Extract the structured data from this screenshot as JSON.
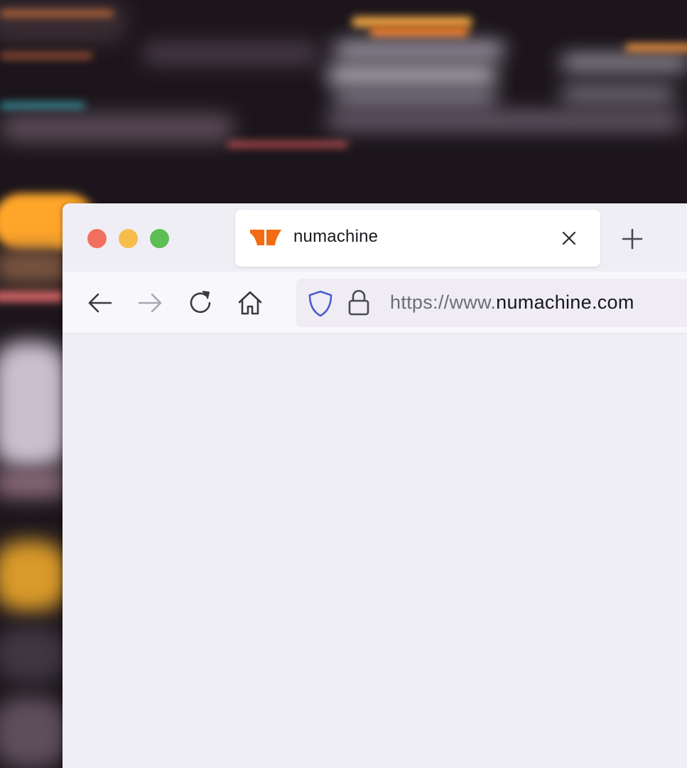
{
  "window": {
    "controls": {
      "close_color": "#f2705f",
      "minimize_color": "#f6bd4b",
      "maximize_color": "#5cbe55"
    }
  },
  "tab": {
    "title": "numachine",
    "favicon": "numachine-logo-icon",
    "favicon_color": "#f36b12",
    "close_icon": "close-icon"
  },
  "tabbar": {
    "new_tab_icon": "plus-icon"
  },
  "toolbar": {
    "back_icon": "arrow-left-icon",
    "forward_icon": "arrow-right-icon",
    "reload_icon": "reload-icon",
    "home_icon": "home-icon"
  },
  "urlbar": {
    "shield_icon": "shield-icon",
    "shield_color": "#4a5bd4",
    "lock_icon": "lock-icon",
    "url_scheme": "https://www.",
    "url_domain": "numachine.com"
  }
}
